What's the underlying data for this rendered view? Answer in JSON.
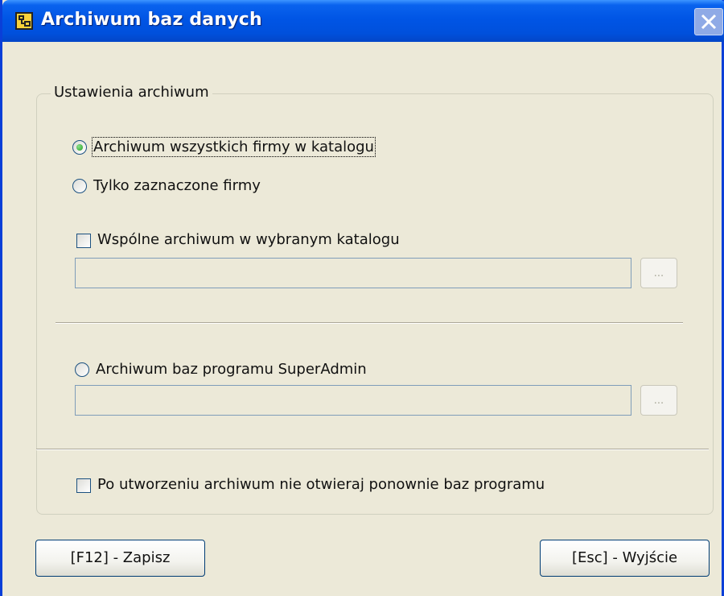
{
  "window": {
    "title": "Archiwum baz danych",
    "app_icon": "database-app-icon",
    "close_icon": "close-icon"
  },
  "settings": {
    "group_label": "Ustawienia archiwum",
    "radio_all": {
      "label": "Archiwum wszystkich firmy w katalogu",
      "checked": true
    },
    "radio_selected": {
      "label": "Tylko zaznaczone firmy",
      "checked": false
    },
    "shared_archive": {
      "label": "Wspólne archiwum w wybranym katalogu",
      "checked": false,
      "path_value": "",
      "browse_label": "..."
    },
    "superadmin": {
      "label": "Archiwum baz programu SuperAdmin",
      "checked": false,
      "path_value": "",
      "browse_label": "..."
    },
    "no_reopen": {
      "label": "Po utworzeniu archiwum nie otwieraj ponownie baz programu",
      "checked": false
    }
  },
  "buttons": {
    "save": "[F12] - Zapisz",
    "exit": "[Esc] - Wyjście"
  }
}
